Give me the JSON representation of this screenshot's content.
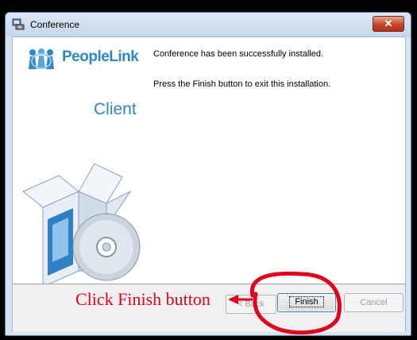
{
  "window": {
    "title": "Conference",
    "close_symbol": "✕"
  },
  "branding": {
    "logo_text": "PeopleLink",
    "product_label": "Client"
  },
  "messages": {
    "installed": "Conference has been successfully installed.",
    "instruction": "Press the Finish button to exit this installation."
  },
  "buttons": {
    "back_label": "< Back",
    "finish_label": "Finish",
    "cancel_label": "Cancel"
  },
  "annotation": {
    "text": "Click Finish button",
    "color": "#e3001b"
  },
  "icons": {
    "app": "installer-icon",
    "logo": "peoplelink-logo-icon",
    "artwork": "software-box-cd-icon"
  }
}
